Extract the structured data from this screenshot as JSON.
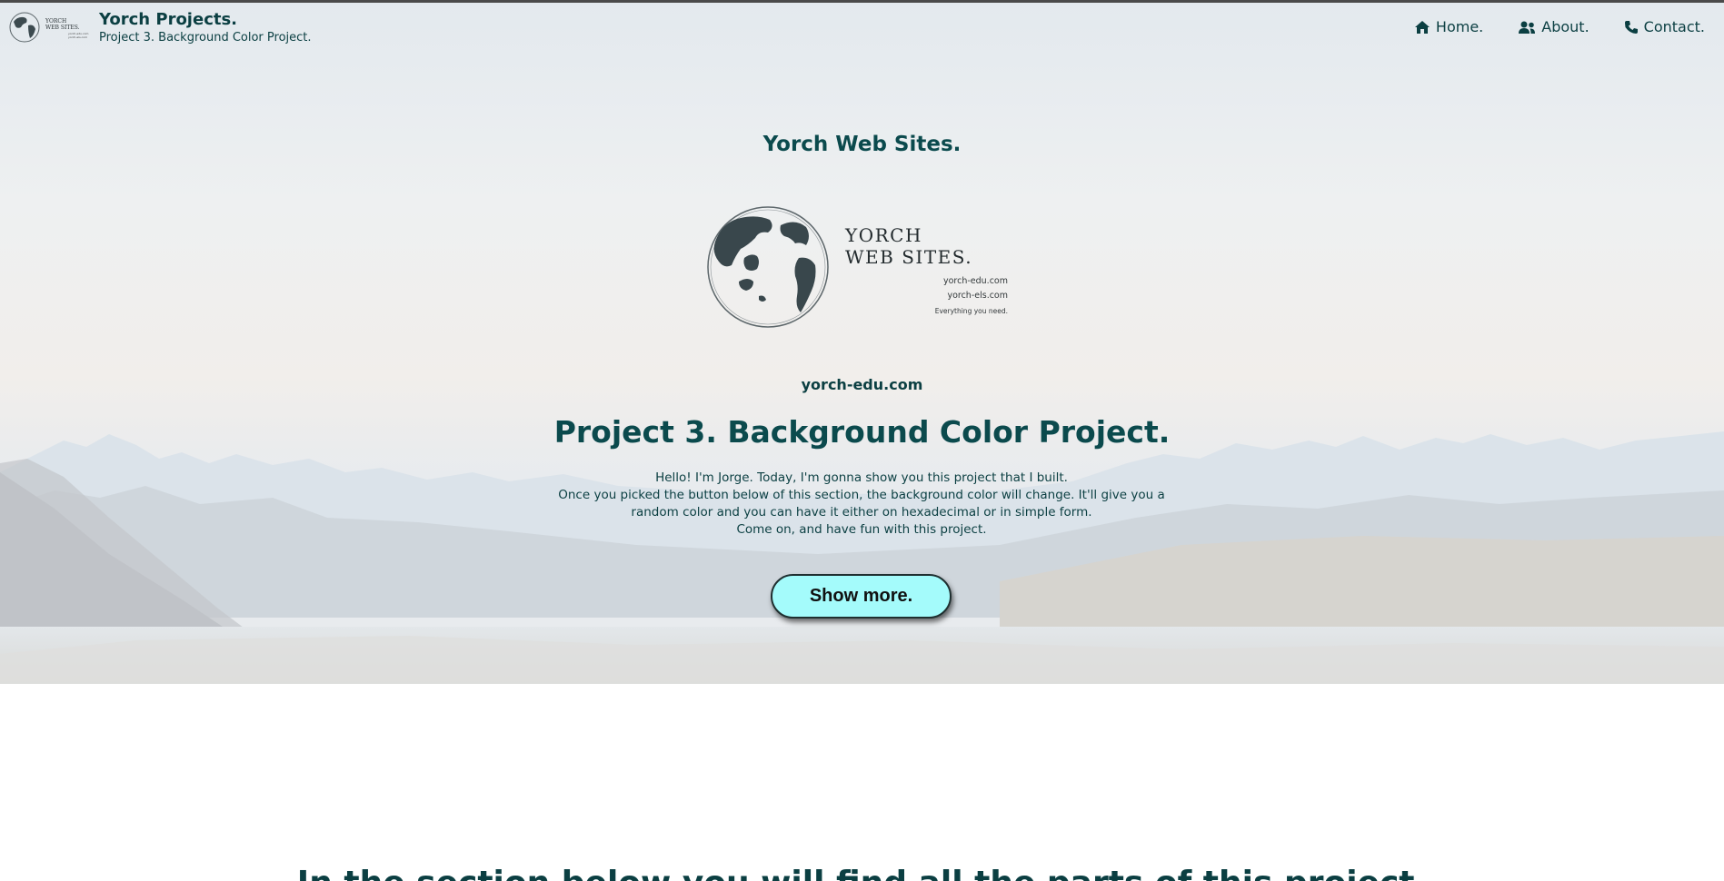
{
  "navbar": {
    "brand_title": "Yorch Projects.",
    "brand_subtitle": "Project 3. Background Color Project.",
    "logo_text_line1": "YORCH",
    "logo_text_line2": "WEB SITES.",
    "links": [
      {
        "label": "Home.",
        "icon": "home-icon"
      },
      {
        "label": "About.",
        "icon": "users-icon"
      },
      {
        "label": "Contact.",
        "icon": "phone-icon"
      }
    ]
  },
  "hero": {
    "site_name": "Yorch Web Sites.",
    "logo": {
      "line1": "YORCH",
      "line2": "WEB SITES.",
      "url1": "yorch-edu.com",
      "url2": "yorch-els.com",
      "tagline": "Everything you need."
    },
    "domain": "yorch-edu.com",
    "title": "Project 3. Background Color Project.",
    "intro": [
      "Hello! I'm Jorge. Today, I'm gonna show you this project that I built.",
      "Once you picked the button below of this section, the background color will change. It'll give you a random color and you can have it either on hexadecimal or in simple form.",
      "Come on, and have fun with this project."
    ],
    "button_label": "Show more."
  },
  "section": {
    "heading": "In the section below you will find all the parts of this project."
  },
  "colors": {
    "text": "#0b4a4d",
    "button": "#a4fbfb"
  }
}
